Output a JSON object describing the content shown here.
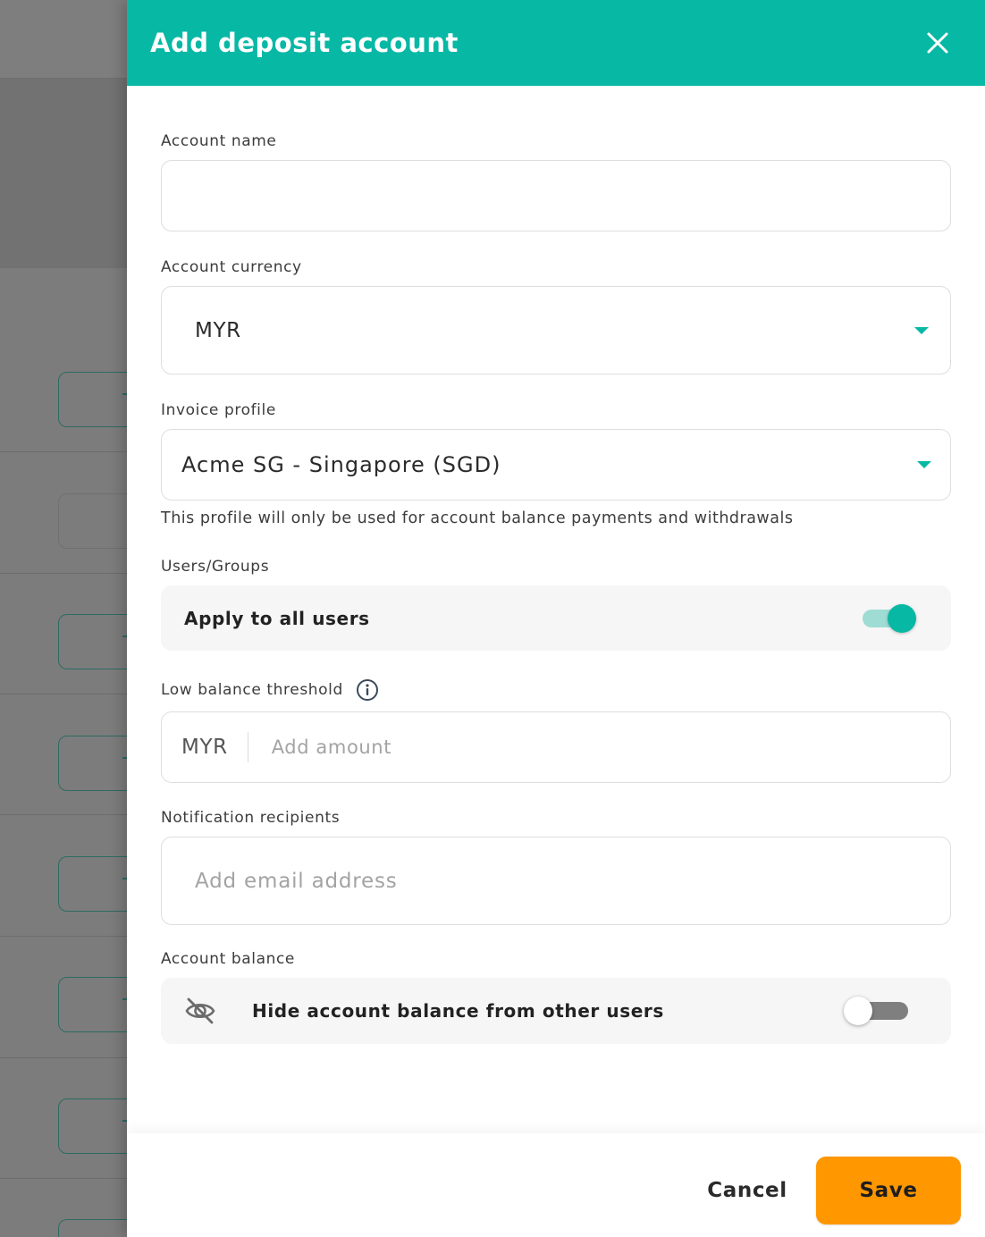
{
  "drawer": {
    "title": "Add deposit account",
    "close_icon": "close-icon"
  },
  "form": {
    "account_name": {
      "label": "Account name",
      "value": "",
      "placeholder": ""
    },
    "account_currency": {
      "label": "Account currency",
      "value": "MYR"
    },
    "invoice_profile": {
      "label": "Invoice profile",
      "value": "Acme SG - Singapore (SGD)",
      "helper": "This profile will only be used for account balance payments and withdrawals"
    },
    "users_groups": {
      "label": "Users/Groups",
      "toggle_label": "Apply to all users",
      "enabled": true
    },
    "low_balance_threshold": {
      "label": "Low balance threshold",
      "currency": "MYR",
      "placeholder": "Add amount",
      "info_icon": "info-icon"
    },
    "notification_recipients": {
      "label": "Notification recipients",
      "placeholder": "Add email address"
    },
    "account_balance": {
      "label": "Account balance",
      "toggle_label": "Hide account balance from other users",
      "enabled": false,
      "icon": "eye-off-icon"
    }
  },
  "footer": {
    "cancel_label": "Cancel",
    "save_label": "Save"
  },
  "colors": {
    "accent": "#07b8a5",
    "save": "#ff9700",
    "overlay": "#7c7c7c"
  }
}
